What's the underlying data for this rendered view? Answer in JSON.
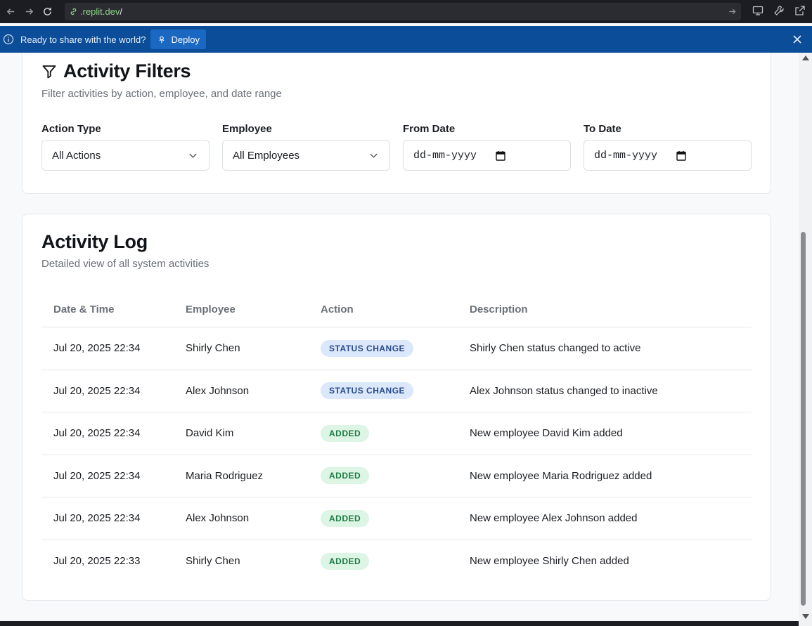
{
  "browser": {
    "url_host": ".replit.dev",
    "url_path": "/",
    "icons": [
      "back-arrow-icon",
      "forward-arrow-icon",
      "reload-icon",
      "link-icon",
      "go-arrow-icon",
      "monitor-icon",
      "wrench-icon",
      "external-link-icon"
    ]
  },
  "banner": {
    "message": "Ready to share with the world?",
    "deploy_label": "Deploy",
    "color": "#0b4d98"
  },
  "filters": {
    "title": "Activity Filters",
    "subtitle": "Filter activities by action, employee, and date range",
    "action_type": {
      "label": "Action Type",
      "value": "All Actions"
    },
    "employee": {
      "label": "Employee",
      "value": "All Employees"
    },
    "from_date": {
      "label": "From Date",
      "placeholder": "dd-mm-yyyy"
    },
    "to_date": {
      "label": "To Date",
      "placeholder": "dd-mm-yyyy"
    }
  },
  "log": {
    "title": "Activity Log",
    "subtitle": "Detailed view of all system activities",
    "columns": [
      "Date & Time",
      "Employee",
      "Action",
      "Description"
    ],
    "rows": [
      {
        "datetime": "Jul 20, 2025 22:34",
        "employee": "Shirly Chen",
        "action": "STATUS CHANGE",
        "action_kind": "status",
        "description": "Shirly Chen status changed to active"
      },
      {
        "datetime": "Jul 20, 2025 22:34",
        "employee": "Alex Johnson",
        "action": "STATUS CHANGE",
        "action_kind": "status",
        "description": "Alex Johnson status changed to inactive"
      },
      {
        "datetime": "Jul 20, 2025 22:34",
        "employee": "David Kim",
        "action": "ADDED",
        "action_kind": "added",
        "description": "New employee David Kim added"
      },
      {
        "datetime": "Jul 20, 2025 22:34",
        "employee": "Maria Rodriguez",
        "action": "ADDED",
        "action_kind": "added",
        "description": "New employee Maria Rodriguez added"
      },
      {
        "datetime": "Jul 20, 2025 22:34",
        "employee": "Alex Johnson",
        "action": "ADDED",
        "action_kind": "added",
        "description": "New employee Alex Johnson added"
      },
      {
        "datetime": "Jul 20, 2025 22:33",
        "employee": "Shirly Chen",
        "action": "ADDED",
        "action_kind": "added",
        "description": "New employee Shirly Chen added"
      }
    ]
  },
  "colors": {
    "status_badge_bg": "#dbe8fb",
    "status_badge_text": "#2a4a8a",
    "added_badge_bg": "#dcf5e4",
    "added_badge_text": "#1d7a45"
  }
}
